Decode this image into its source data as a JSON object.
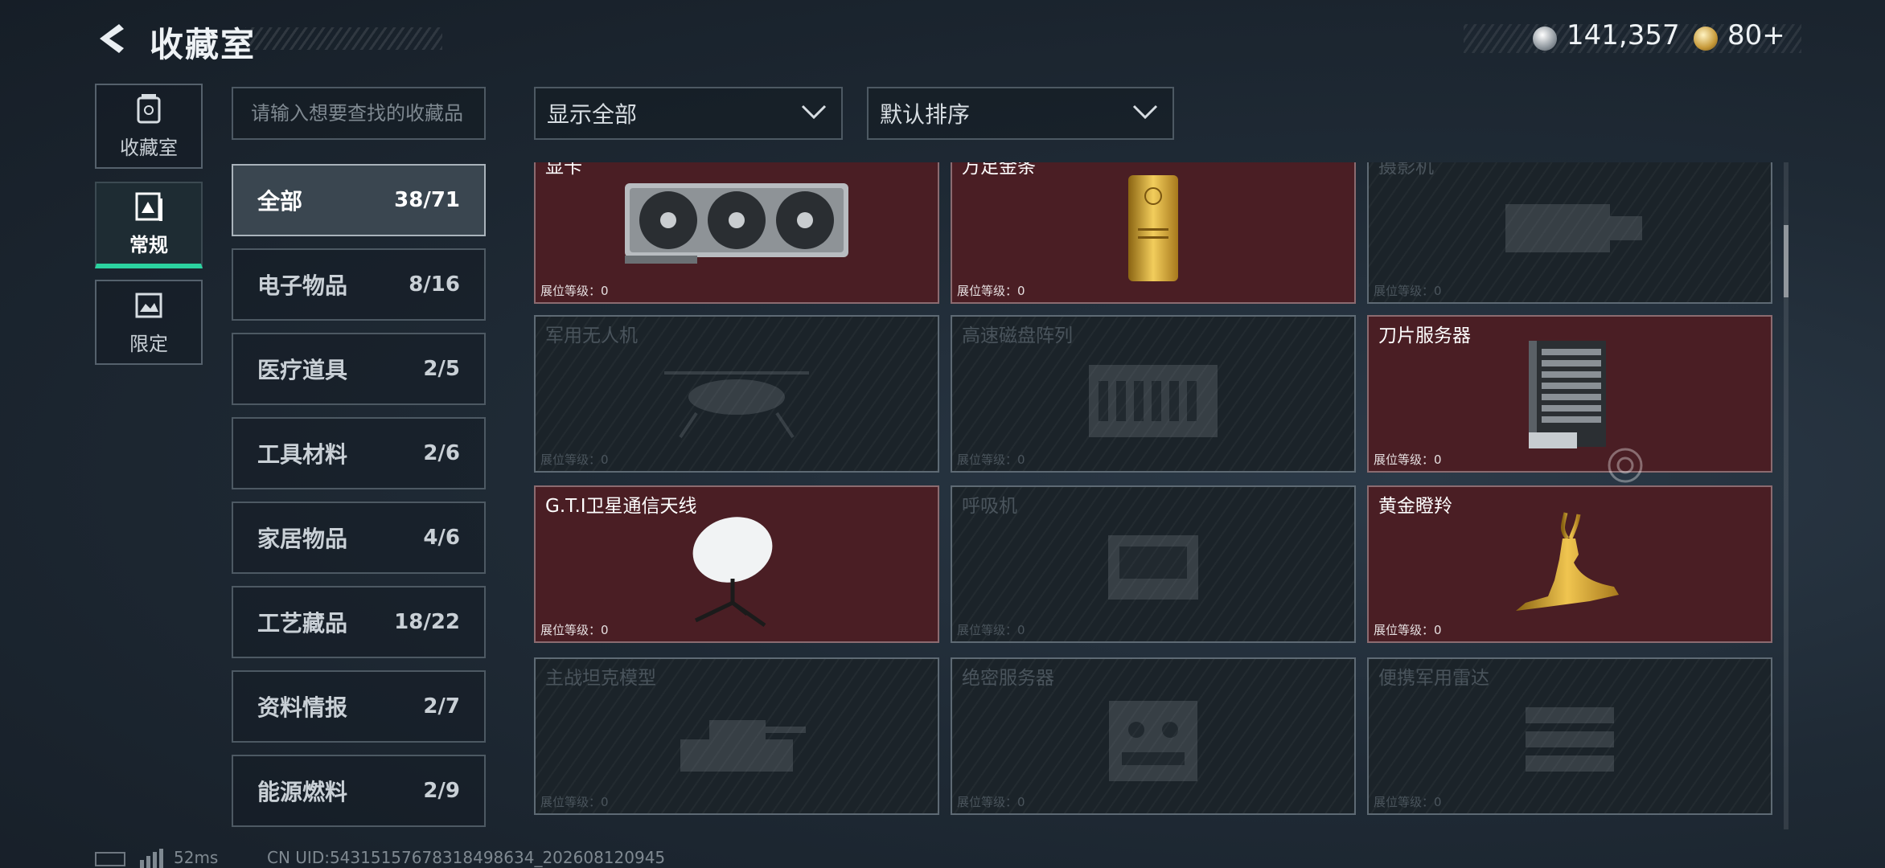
{
  "header": {
    "title": "收藏室",
    "currency1": {
      "icon": "silver-coin-icon",
      "value": "141,357"
    },
    "currency2": {
      "icon": "gold-coin-icon",
      "value": "80+"
    }
  },
  "nav": [
    {
      "label": "收藏室",
      "icon": "jar-icon",
      "active": false
    },
    {
      "label": "常规",
      "icon": "picture-icon",
      "active": true
    },
    {
      "label": "限定",
      "icon": "landscape-icon",
      "active": false
    }
  ],
  "search": {
    "placeholder": "请输入想要查找的收藏品"
  },
  "filter": {
    "selected": "显示全部"
  },
  "sort": {
    "selected": "默认排序"
  },
  "categories": [
    {
      "name": "全部",
      "count": "38/71",
      "active": true
    },
    {
      "name": "电子物品",
      "count": "8/16"
    },
    {
      "name": "医疗道具",
      "count": "2/5"
    },
    {
      "name": "工具材料",
      "count": "2/6"
    },
    {
      "name": "家居物品",
      "count": "4/6"
    },
    {
      "name": "工艺藏品",
      "count": "18/22"
    },
    {
      "name": "资料情报",
      "count": "2/7"
    },
    {
      "name": "能源燃料",
      "count": "2/9"
    }
  ],
  "items": [
    {
      "name": "显卡",
      "level": "展位等级：0",
      "unlocked": true,
      "icon": "graphics-card-icon"
    },
    {
      "name": "万足金条",
      "level": "展位等级：0",
      "unlocked": true,
      "icon": "gold-bar-icon"
    },
    {
      "name": "摄影机",
      "level": "展位等级：0",
      "unlocked": false,
      "icon": "camera-icon"
    },
    {
      "name": "军用无人机",
      "level": "展位等级：0",
      "unlocked": false,
      "icon": "drone-icon"
    },
    {
      "name": "高速磁盘阵列",
      "level": "展位等级：0",
      "unlocked": false,
      "icon": "disk-array-icon"
    },
    {
      "name": "刀片服务器",
      "level": "展位等级：0",
      "unlocked": true,
      "icon": "blade-server-icon"
    },
    {
      "name": "G.T.I卫星通信天线",
      "level": "展位等级：0",
      "unlocked": true,
      "icon": "satellite-dish-icon"
    },
    {
      "name": "呼吸机",
      "level": "展位等级：0",
      "unlocked": false,
      "icon": "ventilator-icon"
    },
    {
      "name": "黄金瞪羚",
      "level": "展位等级：0",
      "unlocked": true,
      "icon": "golden-gazelle-icon"
    },
    {
      "name": "主战坦克模型",
      "level": "展位等级：0",
      "unlocked": false,
      "icon": "tank-model-icon"
    },
    {
      "name": "绝密服务器",
      "level": "展位等级：0",
      "unlocked": false,
      "icon": "secret-server-icon"
    },
    {
      "name": "便携军用雷达",
      "level": "展位等级：0",
      "unlocked": false,
      "icon": "radar-icon"
    }
  ],
  "footer": {
    "ping": "52ms",
    "uid": "CN UID:543151576783184986​34_202608120945"
  }
}
